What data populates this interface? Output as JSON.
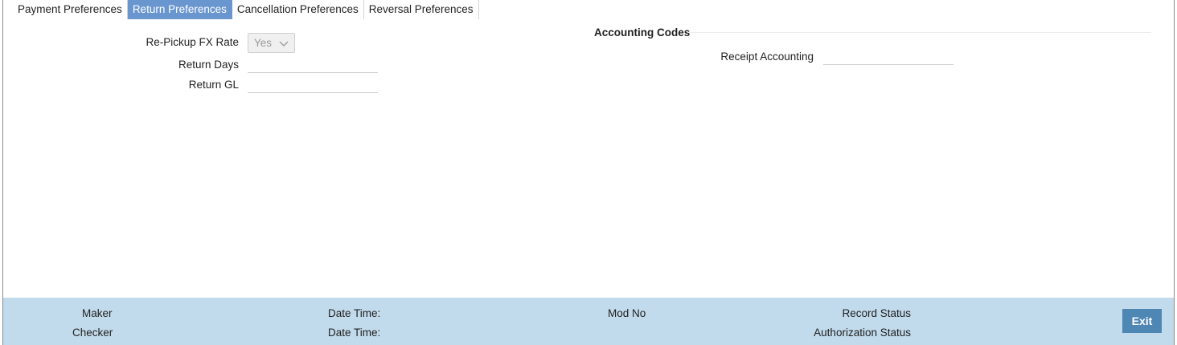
{
  "tabs": [
    {
      "label": "Payment Preferences",
      "active": false
    },
    {
      "label": "Return Preferences",
      "active": true
    },
    {
      "label": "Cancellation Preferences",
      "active": false
    },
    {
      "label": "Reversal Preferences",
      "active": false
    }
  ],
  "form": {
    "repickup_fx_rate_label": "Re-Pickup FX Rate",
    "repickup_fx_rate_value": "Yes",
    "return_days_label": "Return Days",
    "return_days_value": "",
    "return_gl_label": "Return GL",
    "return_gl_value": ""
  },
  "accounting": {
    "section_title": "Accounting Codes",
    "receipt_accounting_label": "Receipt Accounting",
    "receipt_accounting_value": ""
  },
  "footer": {
    "maker_label": "Maker",
    "checker_label": "Checker",
    "date_time_label_1": "Date Time:",
    "date_time_label_2": "Date Time:",
    "mod_no_label": "Mod No",
    "record_status_label": "Record Status",
    "authorization_status_label": "Authorization Status",
    "exit_label": "Exit"
  },
  "colors": {
    "active_tab": "#6a96cf",
    "footer_bg": "#c2dbec",
    "exit_button": "#4e86b4"
  },
  "icons": {
    "select_chevron": "chevron-down-icon"
  }
}
